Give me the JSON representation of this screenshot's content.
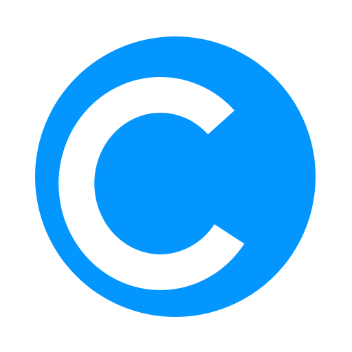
{
  "logo": {
    "icon": "copyright-c-logo-icon",
    "letter": "C",
    "colors": {
      "background": "#ffffff",
      "circle": "#0496ff",
      "letter": "#ffffff"
    }
  }
}
